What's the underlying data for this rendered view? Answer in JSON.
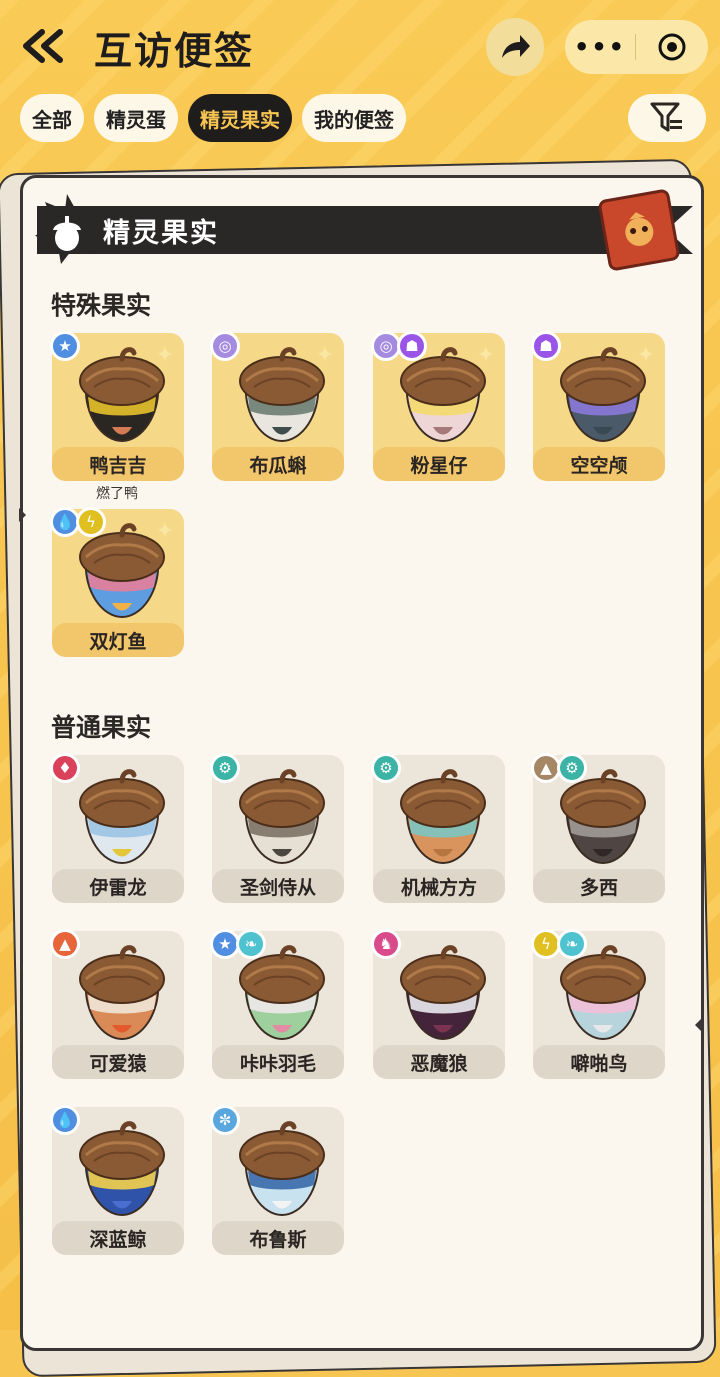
{
  "header": {
    "title": "互访便签",
    "menu_dots": "•••"
  },
  "tabs": [
    {
      "label": "全部",
      "active": false
    },
    {
      "label": "精灵蛋",
      "active": false
    },
    {
      "label": "精灵果实",
      "active": true
    },
    {
      "label": "我的便签",
      "active": false
    }
  ],
  "banner": {
    "title": "精灵果实"
  },
  "sections": {
    "special": {
      "title": "特殊果实",
      "items": [
        {
          "name": "鸭吉吉",
          "sub": "燃了鸭",
          "badges": [
            "star"
          ],
          "colors": [
            "#2a2622",
            "#e7c22b",
            "#d47a55"
          ]
        },
        {
          "name": "布瓜蝌",
          "badges": [
            "swirl"
          ],
          "colors": [
            "#e9e6df",
            "#6c7d71",
            "#3f4e4c"
          ]
        },
        {
          "name": "粉星仔",
          "badges": [
            "swirl",
            "ghost"
          ],
          "colors": [
            "#efd6d6",
            "#f3da6c",
            "#a5787a"
          ]
        },
        {
          "name": "空空颅",
          "badges": [
            "ghost"
          ],
          "colors": [
            "#4b5a68",
            "#8b79d9",
            "#3a4854"
          ]
        },
        {
          "name": "双灯鱼",
          "badges": [
            "water",
            "electric"
          ],
          "colors": [
            "#5e9de0",
            "#e57e9a",
            "#f0b246"
          ]
        }
      ]
    },
    "normal": {
      "title": "普通果实",
      "items": [
        {
          "name": "伊雷龙",
          "badges": [
            "dragon"
          ],
          "colors": [
            "#dfe7ef",
            "#9cc4e4",
            "#e3c63a"
          ]
        },
        {
          "name": "圣剑侍从",
          "badges": [
            "mech"
          ],
          "colors": [
            "#e6e0d4",
            "#7c7366",
            "#4a4640"
          ]
        },
        {
          "name": "机械方方",
          "badges": [
            "mech"
          ],
          "colors": [
            "#d9935c",
            "#7cc6c3",
            "#b5763f"
          ]
        },
        {
          "name": "多西",
          "badges": [
            "ground",
            "mech"
          ],
          "colors": [
            "#4f4644",
            "#a09a98",
            "#2e2826"
          ]
        },
        {
          "name": "可爱猿",
          "badges": [
            "fire"
          ],
          "colors": [
            "#d98a56",
            "#f1e6d8",
            "#e25a2e"
          ]
        },
        {
          "name": "咔咔羽毛",
          "badges": [
            "star",
            "wing"
          ],
          "colors": [
            "#9ed09e",
            "#f0e8ea",
            "#e38aa4"
          ]
        },
        {
          "name": "恶魔狼",
          "badges": [
            "demon"
          ],
          "colors": [
            "#43243a",
            "#eaeaf0",
            "#7a3350"
          ]
        },
        {
          "name": "噼啪鸟",
          "badges": [
            "electric",
            "wing"
          ],
          "colors": [
            "#b7d4dc",
            "#f2c0d8",
            "#e8e8e8"
          ]
        },
        {
          "name": "深蓝鲸",
          "badges": [
            "water"
          ],
          "colors": [
            "#2f53a8",
            "#f4d24a",
            "#4a6ed0"
          ]
        },
        {
          "name": "布鲁斯",
          "badges": [
            "ice"
          ],
          "colors": [
            "#c9e2f0",
            "#3a6aa8",
            "#f3f3f3"
          ]
        }
      ]
    }
  },
  "badge_colors": {
    "star": "#4f8ee0",
    "swirl": "#a58be0",
    "ghost": "#9a55e8",
    "water": "#4f8ee0",
    "electric": "#e0c020",
    "dragon": "#d9425a",
    "mech": "#3bb4a6",
    "ground": "#a58766",
    "fire": "#e6653a",
    "wing": "#4ec2cf",
    "demon": "#d94b8a",
    "ice": "#5aa7e0"
  },
  "badge_glyphs": {
    "star": "★",
    "swirl": "◎",
    "ghost": "☗",
    "water": "💧",
    "electric": "ϟ",
    "dragon": "♦",
    "mech": "⚙",
    "ground": "▲",
    "fire": "▲",
    "wing": "❧",
    "demon": "♞",
    "ice": "✼"
  }
}
